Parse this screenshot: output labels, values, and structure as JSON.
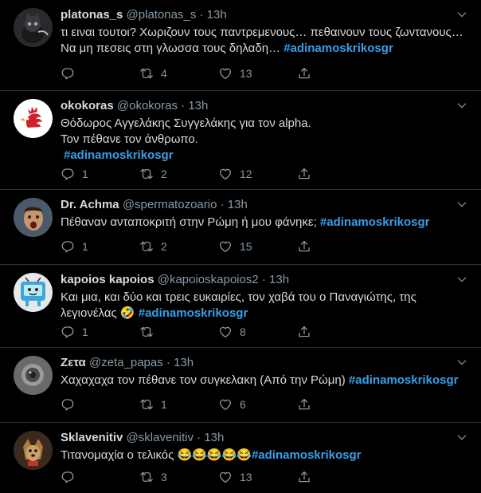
{
  "tweets": [
    {
      "name": "platonas_s",
      "handle": "@platonas_s",
      "time": "13h",
      "text_1": "τι ειναι τουτοι? Χωριζουν τους παντρεμενους… πεθαινουν τους ζωντανους… Να μη πεσεις στη γλωσσα τους δηλαδη… ",
      "hashtag": "#adinamoskrikosgr",
      "reply_count": "",
      "retweet_count": "4",
      "like_count": "13"
    },
    {
      "name": "okokoras",
      "handle": "@okokoras",
      "time": "13h",
      "line_1": "Θόδωρος Αγγελάκης Συγγελάκης για τον alpha.",
      "line_2": "Τον πέθανε τον άνθρωπο.",
      "hashtag": "#adinamoskrikosgr",
      "reply_count": "1",
      "retweet_count": "2",
      "like_count": "12"
    },
    {
      "name": "Dr. Achma",
      "handle": "@spermatozoario",
      "time": "13h",
      "text_1": "Πέθαναν ανταποκριτή στην Ρώμη ή μου φάνηκε; ",
      "hashtag": "#adinamoskrikosgr",
      "reply_count": "1",
      "retweet_count": "2",
      "like_count": "15"
    },
    {
      "name": "kapoios kapoios",
      "handle": "@kapoioskapoios2",
      "time": "13h",
      "text_1": "Και μια, και δύο και τρεις ευκαιρίες, τον χαβά του ο Παναγιώτης, της λεγιονέλας ",
      "emoji": "🤣",
      "hashtag": "#adinamoskrikosgr",
      "reply_count": "1",
      "retweet_count": "",
      "like_count": "8"
    },
    {
      "name": "Ζετα",
      "handle": "@zeta_papas",
      "time": "13h",
      "text_1": "Χαχαχαχα τον πέθανε τον συγκελακη (Από την Ρώμη) ",
      "hashtag": "#adinamoskrikosgr",
      "reply_count": "",
      "retweet_count": "1",
      "like_count": "6"
    },
    {
      "name": "Sklavenitiv",
      "handle": "@sklavenitiv",
      "time": "13h",
      "text_1": "Τιτανομαχία ο τελικός ",
      "emoji": "😂😂😂😂😂",
      "hashtag": "#adinamoskrikosgr",
      "reply_count": "",
      "retweet_count": "3",
      "like_count": "13"
    }
  ],
  "icons": {
    "reply": "reply-icon",
    "retweet": "retweet-icon",
    "like": "like-icon",
    "share": "share-icon",
    "caret": "chevron-down-icon"
  },
  "colors": {
    "background": "#000000",
    "text": "#d9d9d9",
    "muted": "#8899a6",
    "hashtag": "#3a9ee8",
    "divider": "#2f3336"
  }
}
